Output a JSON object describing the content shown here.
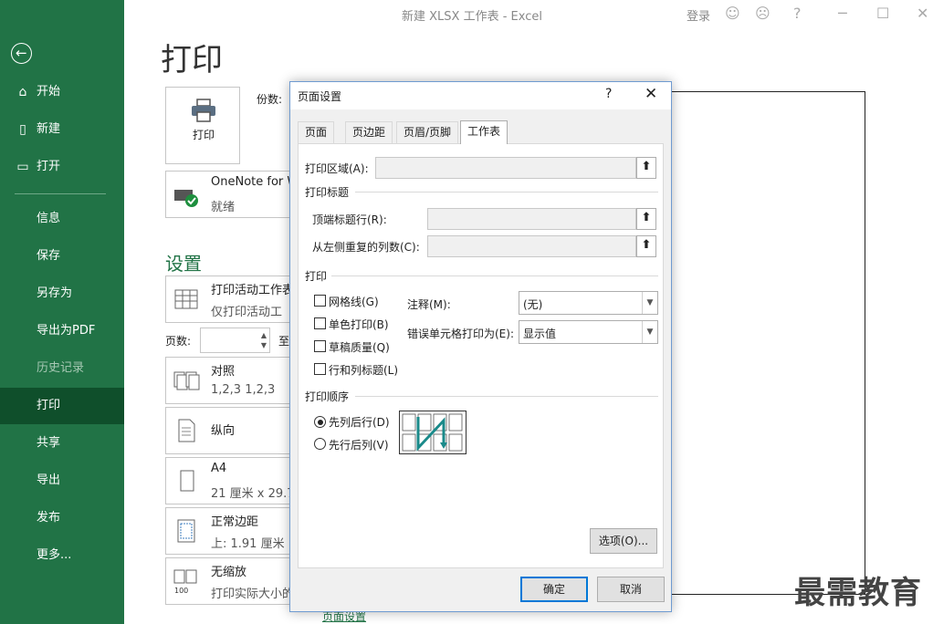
{
  "window": {
    "title": "新建 XLSX 工作表  -  Excel",
    "login": "登录"
  },
  "sidebar": {
    "items": [
      {
        "label": "开始"
      },
      {
        "label": "新建"
      },
      {
        "label": "打开"
      },
      {
        "label": "信息"
      },
      {
        "label": "保存"
      },
      {
        "label": "另存为"
      },
      {
        "label": "导出为PDF"
      },
      {
        "label": "历史记录"
      },
      {
        "label": "打印"
      },
      {
        "label": "共享"
      },
      {
        "label": "导出"
      },
      {
        "label": "发布"
      },
      {
        "label": "更多..."
      }
    ],
    "active": "打印",
    "accent": "#217346"
  },
  "print": {
    "heading": "打印",
    "print_button": "打印",
    "copies_label": "份数:",
    "printer": {
      "name": "OneNote for W",
      "status": "就绪"
    },
    "settings_heading": "设置",
    "sheet_option": {
      "line1": "打印活动工作表",
      "line2": "仅打印活动工"
    },
    "pages_label": "页数:",
    "pages_to": "至",
    "collate": {
      "line1": "对照",
      "line2": "1,2,3    1,2,3"
    },
    "orientation": {
      "line1": "纵向"
    },
    "paper": {
      "line1": "A4",
      "line2": "21 厘米 x 29.7"
    },
    "margins": {
      "line1": "正常边距",
      "line2": "上: 1.91 厘米"
    },
    "scaling": {
      "line1": "无缩放",
      "line2": "打印实际大小的"
    },
    "page_setup_link": "页面设置"
  },
  "dialog": {
    "title": "页面设置",
    "help": "?",
    "close": "✕",
    "tabs": [
      "页面",
      "页边距",
      "页眉/页脚",
      "工作表"
    ],
    "active_tab": "工作表",
    "print_area_label": "打印区域(A):",
    "print_titles_label": "打印标题",
    "rows_repeat_label": "顶端标题行(R):",
    "cols_repeat_label": "从左侧重复的列数(C):",
    "print_group_label": "打印",
    "checkboxes": [
      {
        "label": "网格线(G)",
        "checked": false
      },
      {
        "label": "单色打印(B)",
        "checked": false
      },
      {
        "label": "草稿质量(Q)",
        "checked": false
      },
      {
        "label": "行和列标题(L)",
        "checked": false
      }
    ],
    "comments_label": "注释(M):",
    "comments_value": "(无)",
    "errors_label": "错误单元格打印为(E):",
    "errors_value": "显示值",
    "order_group_label": "打印顺序",
    "order_options": [
      {
        "label": "先列后行(D)",
        "selected": true
      },
      {
        "label": "先行后列(V)",
        "selected": false
      }
    ],
    "options_button": "选项(O)...",
    "ok_button": "确定",
    "cancel_button": "取消"
  },
  "watermark": "最需教育"
}
